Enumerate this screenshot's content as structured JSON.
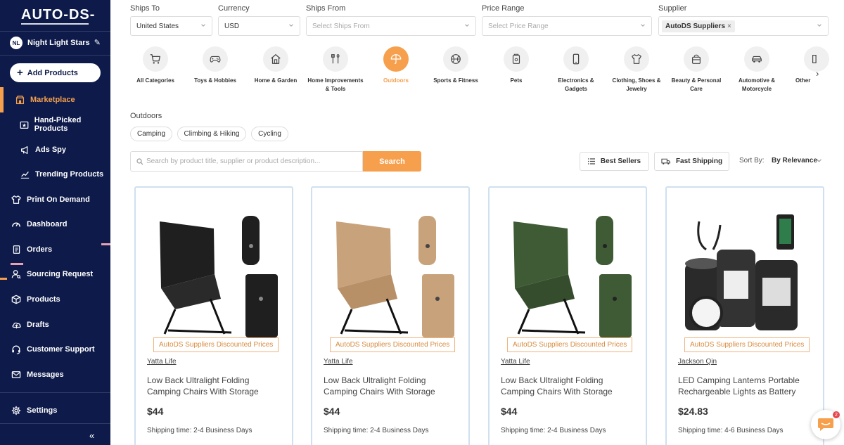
{
  "sidebar": {
    "logo": "AUTO-DS-",
    "store": {
      "initials": "NL",
      "name": "Night Light Stars"
    },
    "add_products": "Add Products",
    "items": [
      {
        "label": "Marketplace",
        "icon": "store-icon"
      },
      {
        "label": "Hand-Picked Products",
        "icon": "star-box-icon"
      },
      {
        "label": "Ads Spy",
        "icon": "megaphone-icon"
      },
      {
        "label": "Trending Products",
        "icon": "trend-icon"
      },
      {
        "label": "Print On Demand",
        "icon": "print-icon"
      },
      {
        "label": "Dashboard",
        "icon": "gauge-icon"
      },
      {
        "label": "Orders",
        "icon": "orders-icon"
      },
      {
        "label": "Sourcing Request",
        "icon": "sourcing-icon"
      },
      {
        "label": "Products",
        "icon": "box-icon"
      },
      {
        "label": "Drafts",
        "icon": "cloud-icon"
      },
      {
        "label": "Customer Support",
        "icon": "support-icon"
      },
      {
        "label": "Messages",
        "icon": "mail-icon"
      },
      {
        "label": "Settings",
        "icon": "gear-icon"
      }
    ],
    "collapse": "«"
  },
  "filters": {
    "ships_to": {
      "label": "Ships To",
      "value": "United States"
    },
    "currency": {
      "label": "Currency",
      "value": "USD"
    },
    "ships_from": {
      "label": "Ships From",
      "placeholder": "Select Ships From"
    },
    "price_range": {
      "label": "Price Range",
      "placeholder": "Select Price Range"
    },
    "supplier": {
      "label": "Supplier",
      "chip": "AutoDS Suppliers",
      "chip_close": "×"
    }
  },
  "categories": [
    {
      "label": "All Categories",
      "icon": "cart-icon"
    },
    {
      "label": "Toys & Hobbies",
      "icon": "gamepad-icon"
    },
    {
      "label": "Home & Garden",
      "icon": "house-icon"
    },
    {
      "label": "Home Improvements & Tools",
      "icon": "tools-icon"
    },
    {
      "label": "Outdoors",
      "icon": "umbrella-icon"
    },
    {
      "label": "Sports & Fitness",
      "icon": "ball-icon"
    },
    {
      "label": "Pets",
      "icon": "pet-food-icon"
    },
    {
      "label": "Electronics & Gadgets",
      "icon": "phone-icon"
    },
    {
      "label": "Clothing, Shoes & Jewelry",
      "icon": "shirt-icon"
    },
    {
      "label": "Beauty & Personal Care",
      "icon": "bag-icon"
    },
    {
      "label": "Automotive & Motorcycle",
      "icon": "car-icon"
    },
    {
      "label": "Other",
      "icon": "other-icon"
    }
  ],
  "subcategory": {
    "title": "Outdoors",
    "pills": [
      "Camping",
      "Climbing & Hiking",
      "Cycling"
    ]
  },
  "search": {
    "placeholder": "Search by product title, supplier or product description...",
    "button": "Search"
  },
  "tools": {
    "best_sellers": "Best Sellers",
    "fast_shipping": "Fast Shipping",
    "sort_label": "Sort By:",
    "sort_value": "By Relevance"
  },
  "products": [
    {
      "badge": "AutoDS Suppliers Discounted Prices",
      "supplier": "Yatta Life",
      "title": "Low Back Ultralight Folding Camping Chairs With Storage Pouch - Black",
      "price": "$44",
      "shipping": "Shipping time: 2-4 Business Days",
      "color": "#1f1f1f"
    },
    {
      "badge": "AutoDS Suppliers Discounted Prices",
      "supplier": "Yatta Life",
      "title": "Low Back Ultralight Folding Camping Chairs With Storage Pouch - Khaki",
      "price": "$44",
      "shipping": "Shipping time: 2-4 Business Days",
      "color": "#c8a27a"
    },
    {
      "badge": "AutoDS Suppliers Discounted Prices",
      "supplier": "Yatta Life",
      "title": "Low Back Ultralight Folding Camping Chairs With Storage Pouch - Army...",
      "price": "$44",
      "shipping": "Shipping time: 2-4 Business Days",
      "color": "#3f5b35"
    },
    {
      "badge": "AutoDS Suppliers Discounted Prices",
      "supplier": "Jackson Qin",
      "title": "LED Camping Lanterns Portable Rechargeable Lights as Battery Ban...",
      "price": "$24.83",
      "shipping": "Shipping time: 4-6 Business Days",
      "color": "#2a2a2a"
    }
  ],
  "chat": {
    "badge": "2"
  },
  "colors": {
    "sidebar": "#0e1b4a",
    "accent": "#f6a04d",
    "card_border": "#cfe0f0"
  }
}
